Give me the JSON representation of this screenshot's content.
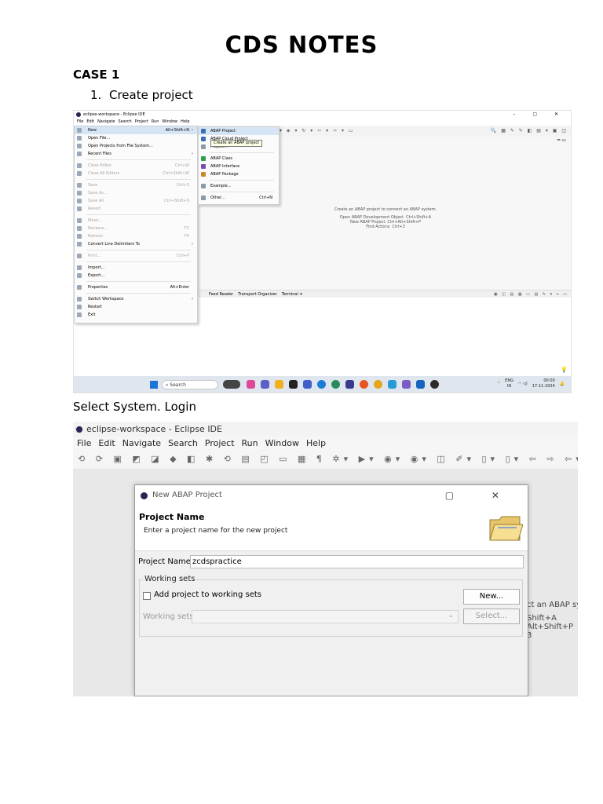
{
  "document": {
    "title": "CDS NOTES",
    "case_heading": "CASE 1",
    "step_number": "1.",
    "step_text": "Create project",
    "paragraph": "Select System. Login"
  },
  "shot1": {
    "window_title": "eclipse-workspace - Eclipse IDE",
    "window_controls": "– ▢ ✕",
    "menubar": [
      "File",
      "Edit",
      "Navigate",
      "Search",
      "Project",
      "Run",
      "Window",
      "Help"
    ],
    "file_menu": [
      {
        "label": "New",
        "shortcut": "Alt+Shift+N",
        "arrow": "›",
        "state": "highlight"
      },
      {
        "label": "Open File...",
        "shortcut": "",
        "arrow": "",
        "state": "normal"
      },
      {
        "label": "Open Projects from File System...",
        "shortcut": "",
        "arrow": "",
        "state": "normal"
      },
      {
        "label": "Recent Files",
        "shortcut": "",
        "arrow": "›",
        "state": "normal"
      },
      {
        "sep": true
      },
      {
        "label": "Close Editor",
        "shortcut": "Ctrl+W",
        "arrow": "",
        "state": "disabled"
      },
      {
        "label": "Close All Editors",
        "shortcut": "Ctrl+Shift+W",
        "arrow": "",
        "state": "disabled"
      },
      {
        "sep": true
      },
      {
        "label": "Save",
        "shortcut": "Ctrl+S",
        "arrow": "",
        "state": "disabled"
      },
      {
        "label": "Save As...",
        "shortcut": "",
        "arrow": "",
        "state": "disabled"
      },
      {
        "label": "Save All",
        "shortcut": "Ctrl+Shift+S",
        "arrow": "",
        "state": "disabled"
      },
      {
        "label": "Revert",
        "shortcut": "",
        "arrow": "",
        "state": "disabled"
      },
      {
        "sep": true
      },
      {
        "label": "Move...",
        "shortcut": "",
        "arrow": "",
        "state": "disabled"
      },
      {
        "label": "Rename...",
        "shortcut": "F2",
        "arrow": "",
        "state": "disabled"
      },
      {
        "label": "Refresh",
        "shortcut": "F5",
        "arrow": "",
        "state": "disabled"
      },
      {
        "label": "Convert Line Delimiters To",
        "shortcut": "",
        "arrow": "›",
        "state": "normal"
      },
      {
        "sep": true
      },
      {
        "label": "Print...",
        "shortcut": "Ctrl+P",
        "arrow": "",
        "state": "disabled"
      },
      {
        "sep": true
      },
      {
        "label": "Import...",
        "shortcut": "",
        "arrow": "",
        "state": "normal"
      },
      {
        "label": "Export...",
        "shortcut": "",
        "arrow": "",
        "state": "normal"
      },
      {
        "sep": true
      },
      {
        "label": "Properties",
        "shortcut": "Alt+Enter",
        "arrow": "",
        "state": "normal"
      },
      {
        "sep": true
      },
      {
        "label": "Switch Workspace",
        "shortcut": "",
        "arrow": "›",
        "state": "normal"
      },
      {
        "label": "Restart",
        "shortcut": "",
        "arrow": "",
        "state": "normal"
      },
      {
        "label": "Exit",
        "shortcut": "",
        "arrow": "",
        "state": "normal"
      }
    ],
    "new_submenu": [
      {
        "label": "ABAP Project",
        "shortcut": "",
        "color": "#3a6fb5",
        "state": "highlight"
      },
      {
        "label": "ABAP Cloud Project",
        "shortcut": "",
        "color": "#3a6fb5",
        "state": "normal"
      },
      {
        "label": "Project...",
        "shortcut": "",
        "color": "#8a9aab",
        "state": "normal"
      },
      {
        "sep": true
      },
      {
        "label": "ABAP Class",
        "shortcut": "",
        "color": "#2e9e48",
        "state": "normal"
      },
      {
        "label": "ABAP Interface",
        "shortcut": "",
        "color": "#7a4fb0",
        "state": "normal"
      },
      {
        "label": "ABAP Package",
        "shortcut": "",
        "color": "#c9892a",
        "state": "normal"
      },
      {
        "sep": true
      },
      {
        "label": "Example...",
        "shortcut": "",
        "color": "#8a9aab",
        "state": "normal"
      },
      {
        "sep": true
      },
      {
        "label": "Other...",
        "shortcut": "Ctrl+N",
        "color": "#8a9aab",
        "state": "normal"
      }
    ],
    "tooltip": "Create an ABAP project",
    "editor_hint": {
      "line1": "Create an ABAP project to connect an ABAP system.",
      "rows": [
        {
          "label": "Open ABAP Development Object",
          "key": "Ctrl+Shift+A"
        },
        {
          "label": "New ABAP Project",
          "key": "Ctrl+Alt+Shift+P"
        },
        {
          "label": "Find Actions",
          "key": "Ctrl+3"
        }
      ]
    },
    "bottom_tabs": [
      "Feed Reader",
      "Transport Organizer",
      "Terminal ✕"
    ],
    "taskbar": {
      "search_placeholder": "Search",
      "lang": "ENG",
      "region": "IN",
      "time": "00:00",
      "date": "17-11-2024"
    }
  },
  "shot2": {
    "window_title": "eclipse-workspace - Eclipse IDE",
    "menubar": [
      "File",
      "Edit",
      "Navigate",
      "Search",
      "Project",
      "Run",
      "Window",
      "Help"
    ],
    "background_hint": [
      "ct an ABAP sys",
      "Shift+A",
      "Alt+Shift+P",
      "3"
    ],
    "dialog": {
      "title": "New ABAP Project",
      "window_controls": "▢ ✕",
      "heading": "Project Name",
      "subheading": "Enter a project name for the new project",
      "project_name_label": "Project Name:",
      "project_name_value": "zcdspractice",
      "working_sets_legend": "Working sets",
      "add_to_sets_label": "Add project to working sets",
      "new_button": "New...",
      "working_sets_label": "Working sets:",
      "select_button": "Select..."
    }
  }
}
